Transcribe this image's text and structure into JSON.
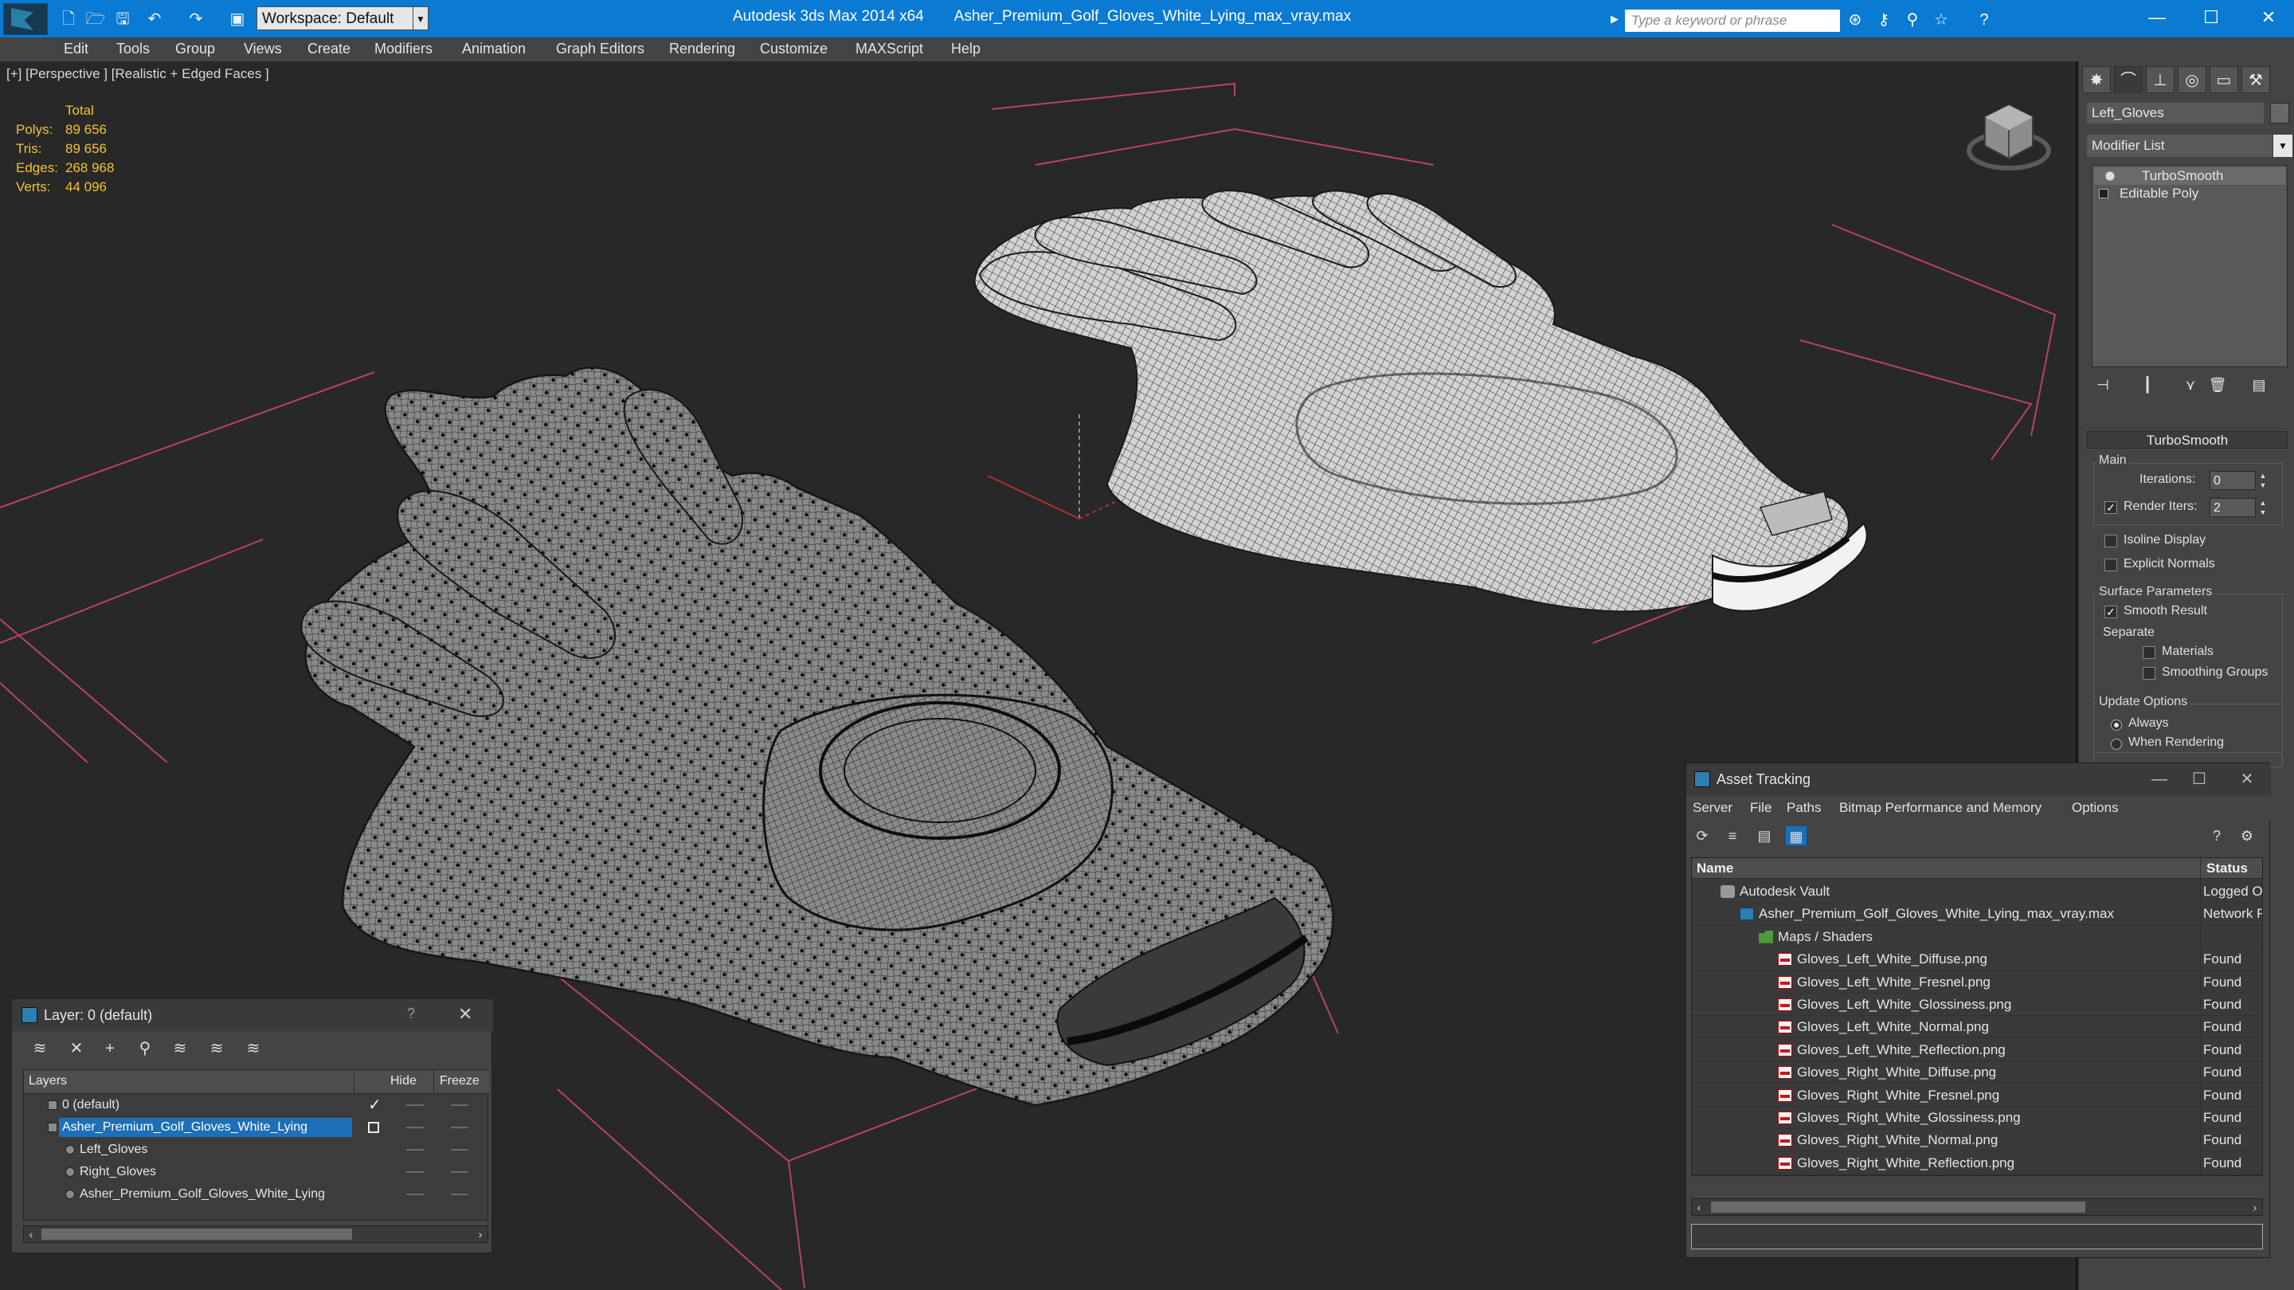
{
  "titlebar": {
    "workspace": "Workspace: Default",
    "app_name": "Autodesk 3ds Max  2014 x64",
    "file_name": "Asher_Premium_Golf_Gloves_White_Lying_max_vray.max",
    "search_placeholder": "Type a keyword or phrase"
  },
  "menu": [
    "Edit",
    "Tools",
    "Group",
    "Views",
    "Create",
    "Modifiers",
    "Animation",
    "Graph Editors",
    "Rendering",
    "Customize",
    "MAXScript",
    "Help"
  ],
  "viewport": {
    "label": "[+] [Perspective ] [Realistic + Edged Faces ]",
    "stats": {
      "header": "Total",
      "rows": [
        {
          "key": "Polys:",
          "value": "89 656"
        },
        {
          "key": "Tris:",
          "value": "89 656"
        },
        {
          "key": "Edges:",
          "value": "268 968"
        },
        {
          "key": "Verts:",
          "value": "44 096"
        }
      ]
    }
  },
  "command_panel": {
    "object_name": "Left_Gloves",
    "modifier_list": "Modifier List",
    "stack": [
      "TurboSmooth",
      "Editable Poly"
    ],
    "rollout_title": "TurboSmooth",
    "main_group": "Main",
    "iterations_label": "Iterations:",
    "iterations_value": "0",
    "render_iters_label": "Render Iters:",
    "render_iters_value": "2",
    "isoline_display": "Isoline Display",
    "explicit_normals": "Explicit Normals",
    "surface_group": "Surface Parameters",
    "smooth_result": "Smooth Result",
    "separate_label": "Separate",
    "materials": "Materials",
    "smoothing_groups": "Smoothing Groups",
    "update_group": "Update Options",
    "always": "Always",
    "when_rendering": "When Rendering"
  },
  "layer_window": {
    "title": "Layer: 0 (default)",
    "help": "?",
    "columns": {
      "layers": "Layers",
      "hide": "Hide",
      "freeze": "Freeze"
    },
    "rows": [
      {
        "name": "0 (default)",
        "indent": 0,
        "selected": false,
        "current": true
      },
      {
        "name": "Asher_Premium_Golf_Gloves_White_Lying",
        "indent": 0,
        "selected": true,
        "current": false
      },
      {
        "name": "Left_Gloves",
        "indent": 1,
        "selected": false,
        "current": false
      },
      {
        "name": "Right_Gloves",
        "indent": 1,
        "selected": false,
        "current": false
      },
      {
        "name": "Asher_Premium_Golf_Gloves_White_Lying",
        "indent": 1,
        "selected": false,
        "current": false
      }
    ]
  },
  "asset_tracking": {
    "title": "Asset Tracking",
    "menu": [
      "Server",
      "File",
      "Paths",
      "Bitmap Performance and Memory",
      "Options"
    ],
    "columns": {
      "name": "Name",
      "status": "Status"
    },
    "rows": [
      {
        "name": "Autodesk Vault",
        "status": "Logged O",
        "icon": "vault",
        "indent": 1
      },
      {
        "name": "Asher_Premium_Golf_Gloves_White_Lying_max_vray.max",
        "status": "Network F",
        "icon": "maxf",
        "indent": 2
      },
      {
        "name": "Maps / Shaders",
        "status": "",
        "icon": "folder",
        "indent": 3
      },
      {
        "name": "Gloves_Left_White_Diffuse.png",
        "status": "Found",
        "icon": "png",
        "indent": 4
      },
      {
        "name": "Gloves_Left_White_Fresnel.png",
        "status": "Found",
        "icon": "png",
        "indent": 4
      },
      {
        "name": "Gloves_Left_White_Glossiness.png",
        "status": "Found",
        "icon": "png",
        "indent": 4
      },
      {
        "name": "Gloves_Left_White_Normal.png",
        "status": "Found",
        "icon": "png",
        "indent": 4
      },
      {
        "name": "Gloves_Left_White_Reflection.png",
        "status": "Found",
        "icon": "png",
        "indent": 4
      },
      {
        "name": "Gloves_Right_White_Diffuse.png",
        "status": "Found",
        "icon": "png",
        "indent": 4
      },
      {
        "name": "Gloves_Right_White_Fresnel.png",
        "status": "Found",
        "icon": "png",
        "indent": 4
      },
      {
        "name": "Gloves_Right_White_Glossiness.png",
        "status": "Found",
        "icon": "png",
        "indent": 4
      },
      {
        "name": "Gloves_Right_White_Normal.png",
        "status": "Found",
        "icon": "png",
        "indent": 4
      },
      {
        "name": "Gloves_Right_White_Reflection.png",
        "status": "Found",
        "icon": "png",
        "indent": 4
      }
    ]
  },
  "colors": {
    "titlebar": "#0a7ad3",
    "stats_text": "#f2c230",
    "selection": "#1d6fb8",
    "grid_lines": "#c8456a"
  }
}
